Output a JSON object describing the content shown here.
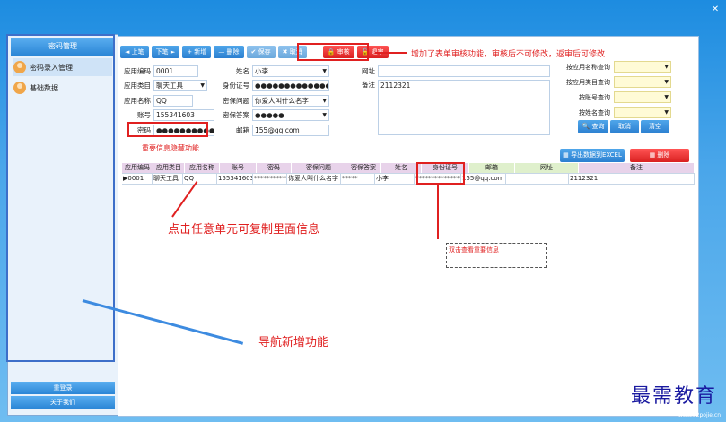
{
  "sidebar": {
    "header": "密码管理",
    "items": [
      {
        "label": "密码录入管理"
      },
      {
        "label": "基础数据"
      }
    ],
    "bottom": [
      "重登录",
      "关于我们"
    ]
  },
  "toolbar": {
    "buttons": [
      "◄ 上笔",
      "下笔 ►",
      "+ 新增",
      "— 删除",
      "✔ 保存",
      "✖ 取消"
    ],
    "audit": "🔒 审核",
    "unaudit": "🔓 退审"
  },
  "form": {
    "app_code_label": "应用编码",
    "app_code": "0001",
    "app_category_label": "应用类目",
    "app_category": "聊天工具",
    "app_name_label": "应用名称",
    "app_name": "QQ",
    "account_label": "账号",
    "account": "155341603",
    "password_label": "密码",
    "password": "●●●●●●●●●●●",
    "name_label": "姓名",
    "name": "小李",
    "id_label": "身份证号",
    "id": "●●●●●●●●●●●●●●●●●●",
    "question_label": "密保问题",
    "question": "你爱人叫什么名字",
    "answer_label": "密保答案",
    "answer": "●●●●●",
    "email_label": "邮箱",
    "email": "155@qq.com",
    "url_label": "网址",
    "url": "",
    "remark_label": "备注",
    "remark": "2112321"
  },
  "query": {
    "labels": [
      "按应用名称查询",
      "按应用类目查询",
      "按账号查询",
      "按姓名查询"
    ],
    "search": "🔍 查询",
    "cancel": "取消",
    "clear": "清空"
  },
  "export": "▦ 导出数据到EXCEL",
  "delete": "▦ 删除",
  "table": {
    "columns": [
      "应用编码",
      "应用类目",
      "应用名称",
      "账号",
      "密码",
      "密保问题",
      "密保答案",
      "姓名",
      "身份证号",
      "邮箱",
      "网址",
      "备注"
    ],
    "row": [
      "▶0001",
      "聊天工具",
      "QQ",
      "155341603",
      "***********",
      "你爱人叫什么名字",
      "*****",
      "小李",
      "*******************",
      "155@qq.com",
      "",
      "2112321"
    ]
  },
  "annotations": {
    "audit_note": "增加了表单审核功能，审核后不可修改，返审后可修改",
    "hide_note": "重要信息隐藏功能",
    "copy_note": "点击任意单元可复制里面信息",
    "dblclick_note": "双击查看重要信息",
    "nav_note": "导航新增功能"
  },
  "watermark": "最需教育",
  "watermark_url": "www.52pojie.cn",
  "close_icon": "✕"
}
